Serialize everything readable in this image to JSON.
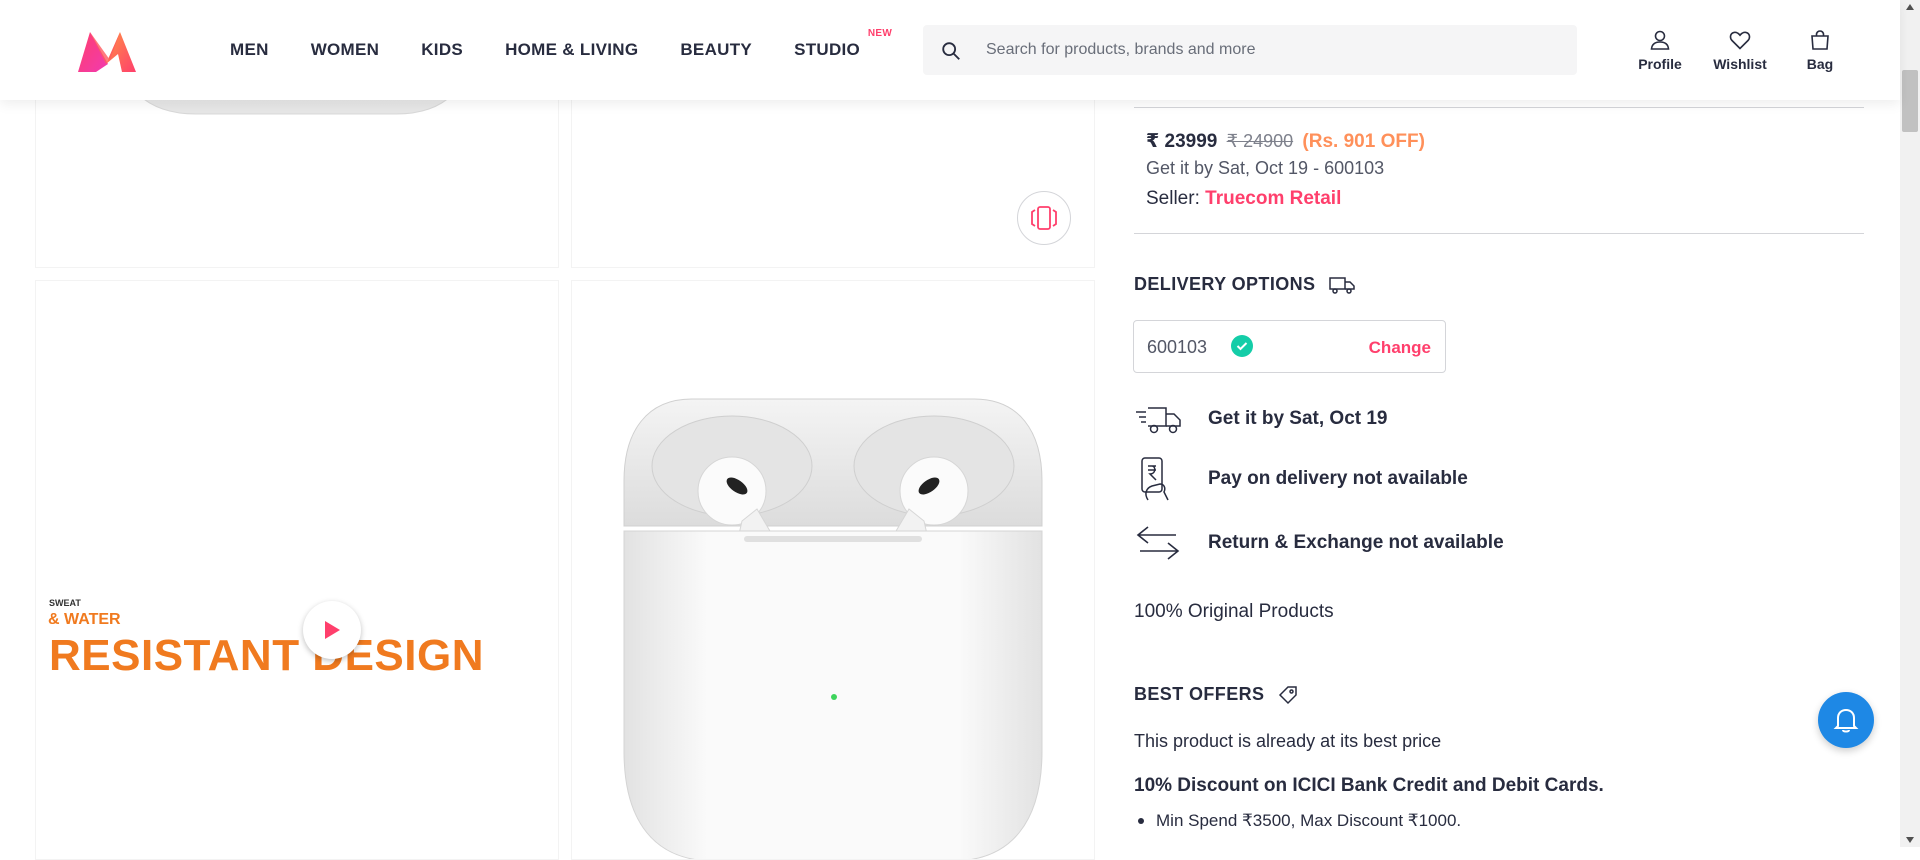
{
  "header": {
    "logo": "myntra-logo",
    "nav": [
      {
        "label": "MEN"
      },
      {
        "label": "WOMEN"
      },
      {
        "label": "KIDS"
      },
      {
        "label": "HOME & LIVING"
      },
      {
        "label": "BEAUTY"
      },
      {
        "label": "STUDIO",
        "badge": "NEW"
      }
    ],
    "search": {
      "placeholder": "Search for products, brands and more",
      "icon": "search-icon"
    },
    "actions": [
      {
        "label": "Profile",
        "icon": "profile-icon"
      },
      {
        "label": "Wishlist",
        "icon": "heart-icon"
      },
      {
        "label": "Bag",
        "icon": "bag-icon"
      }
    ]
  },
  "gallery": {
    "video_text": {
      "line1": "SWEAT",
      "line2": "& WATER",
      "line3": "RESISTANT DESIGN"
    },
    "ar_icon": "view-similar-icon",
    "play_icon": "play-icon"
  },
  "product": {
    "price": "₹ 23999",
    "mrp": "₹ 24900",
    "discount": "(Rs. 901 OFF)",
    "delivery_line": "Get it by Sat, Oct 19 - 600103",
    "seller_label": "Seller:",
    "seller_name": "Truecom Retail"
  },
  "delivery": {
    "title": "DELIVERY OPTIONS",
    "pincode": "600103",
    "change_label": "Change",
    "options": [
      {
        "icon": "truck-fast-icon",
        "text": "Get it by Sat, Oct 19"
      },
      {
        "icon": "cash-on-delivery-icon",
        "text": "Pay on delivery not available"
      },
      {
        "icon": "exchange-arrows-icon",
        "text": "Return & Exchange not available"
      }
    ],
    "original": "100% Original Products"
  },
  "offers": {
    "title": "BEST OFFERS",
    "best_price": "This product is already at its best price",
    "offer_title": "10% Discount on ICICI Bank Credit and Debit Cards.",
    "offer_bullet": "Min Spend ₹3500, Max Discount ₹1000."
  },
  "colors": {
    "brand_pink": "#ff3f6c",
    "discount_orange": "#ff905a",
    "check_green": "#14cda8",
    "bell_blue": "#1e88e5"
  }
}
